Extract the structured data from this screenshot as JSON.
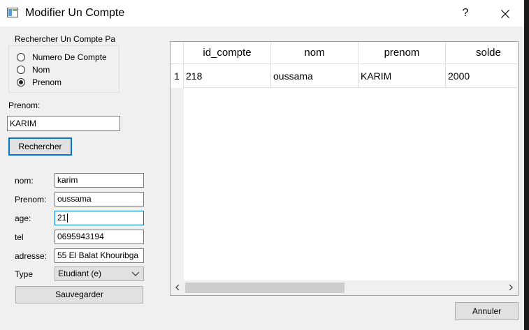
{
  "window": {
    "title": "Modifier Un Compte",
    "help_label": "?",
    "icons": {
      "app": "app-window-icon",
      "close": "close-icon"
    }
  },
  "search": {
    "group_title": "Rechercher Un Compte Pa",
    "options": [
      {
        "label": "Numero De Compte",
        "checked": false
      },
      {
        "label": "Nom",
        "checked": false
      },
      {
        "label": "Prenom",
        "checked": true
      }
    ],
    "field_label": "Prenom:",
    "field_value": "KARIM",
    "button_label": "Rechercher"
  },
  "form": {
    "nom_label": "nom:",
    "nom_value": "karim",
    "prenom_label": "Prenom:",
    "prenom_value": "oussama",
    "age_label": "age:",
    "age_value": "21",
    "tel_label": "tel",
    "tel_value": "0695943194",
    "adresse_label": "adresse:",
    "adresse_value": "55 El Balat Khouribga",
    "type_label": "Type",
    "type_value": "Etudiant (e)",
    "save_label": "Sauvegarder"
  },
  "table": {
    "columns": [
      "id_compte",
      "nom",
      "prenom",
      "solde"
    ],
    "rows": [
      {
        "index": "1",
        "cells": [
          "218",
          "oussama",
          "KARIM",
          "2000"
        ]
      }
    ]
  },
  "footer": {
    "cancel_label": "Annuler"
  }
}
